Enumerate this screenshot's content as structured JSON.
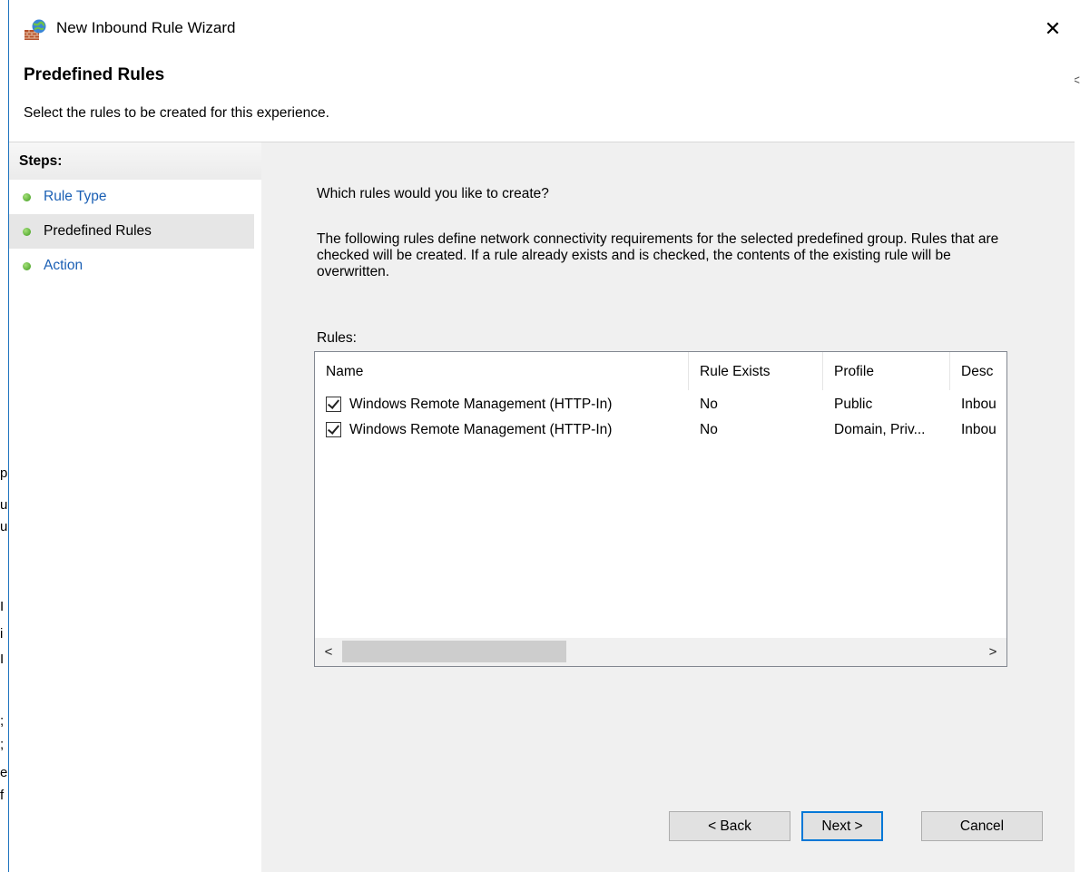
{
  "window": {
    "title": "New Inbound Rule Wizard",
    "close_glyph": "✕"
  },
  "header": {
    "title": "Predefined Rules",
    "subtitle": "Select the rules to be created for this experience."
  },
  "steps": {
    "heading": "Steps:",
    "items": [
      {
        "label": "Rule Type"
      },
      {
        "label": "Predefined Rules"
      },
      {
        "label": "Action"
      }
    ]
  },
  "main": {
    "question": "Which rules would you like to create?",
    "description": "The following rules define network connectivity requirements for the selected predefined group. Rules that are checked will be created. If a rule already exists and is checked, the contents of the existing rule will be overwritten.",
    "rules_label": "Rules:",
    "columns": [
      "Name",
      "Rule Exists",
      "Profile",
      "Desc"
    ],
    "rows": [
      {
        "checked": true,
        "name": "Windows Remote Management (HTTP-In)",
        "exists": "No",
        "profile": "Public",
        "desc": "Inbou"
      },
      {
        "checked": true,
        "name": "Windows Remote Management (HTTP-In)",
        "exists": "No",
        "profile": "Domain, Priv...",
        "desc": "Inbou"
      }
    ],
    "scroll_left": "<",
    "scroll_right": ">"
  },
  "buttons": {
    "back": "< Back",
    "next": "Next >",
    "cancel": "Cancel"
  },
  "background_fragments": {
    "left": [
      "p",
      "u",
      "u",
      "I",
      "i",
      "I",
      ";",
      ";",
      "e",
      "f"
    ],
    "right": [
      "<"
    ]
  },
  "colors": {
    "link": "#1a5fb4",
    "accent": "#0078d7",
    "content_bg": "#f0f0f0"
  }
}
